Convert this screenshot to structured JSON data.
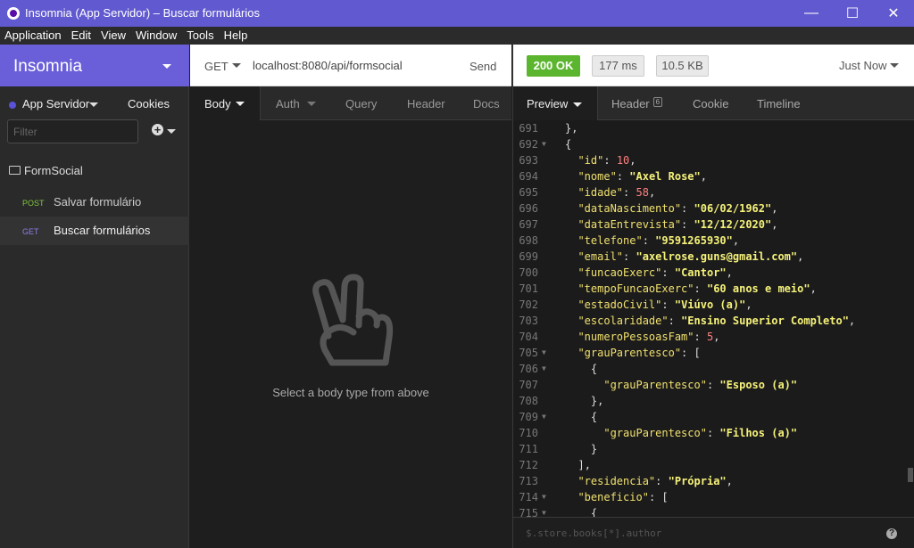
{
  "window": {
    "title": "Insomnia (App Servidor) – Buscar formulários",
    "minimize": "—",
    "maximize": "☐",
    "close": "✕"
  },
  "menu": [
    "Application",
    "Edit",
    "View",
    "Window",
    "Tools",
    "Help"
  ],
  "sidebar": {
    "app_name": "Insomnia",
    "workspace": "App Servidor",
    "cookies": "Cookies",
    "filter_placeholder": "Filter",
    "plus": "+",
    "folder": "FormSocial",
    "requests": [
      {
        "method": "POST",
        "name": "Salvar formulário"
      },
      {
        "method": "GET",
        "name": "Buscar formulários"
      }
    ]
  },
  "request": {
    "method": "GET",
    "url": "localhost:8080/api/formsocial",
    "send": "Send",
    "tabs": [
      "Body",
      "Auth",
      "Query",
      "Header",
      "Docs"
    ],
    "empty_message": "Select a body type from above"
  },
  "response": {
    "status": "200 OK",
    "time": "177 ms",
    "size": "10.5 KB",
    "when": "Just Now",
    "tabs": [
      "Preview",
      "Header",
      "Cookie",
      "Timeline"
    ],
    "header_count": "6",
    "filter_placeholder": "$.store.books[*].author",
    "help": "?",
    "lines": [
      {
        "n": "691",
        "f": "",
        "t": "},"
      },
      {
        "n": "692",
        "f": "▼",
        "t": "{"
      },
      {
        "n": "693",
        "f": "",
        "t": "  \"id\": 10,"
      },
      {
        "n": "694",
        "f": "",
        "t": "  \"nome\": \"Axel Rose\","
      },
      {
        "n": "695",
        "f": "",
        "t": "  \"idade\": 58,"
      },
      {
        "n": "696",
        "f": "",
        "t": "  \"dataNascimento\": \"06/02/1962\","
      },
      {
        "n": "697",
        "f": "",
        "t": "  \"dataEntrevista\": \"12/12/2020\","
      },
      {
        "n": "698",
        "f": "",
        "t": "  \"telefone\": \"9591265930\","
      },
      {
        "n": "699",
        "f": "",
        "t": "  \"email\": \"axelrose.guns@gmail.com\","
      },
      {
        "n": "700",
        "f": "",
        "t": "  \"funcaoExerc\": \"Cantor\","
      },
      {
        "n": "701",
        "f": "",
        "t": "  \"tempoFuncaoExerc\": \"60 anos e meio\","
      },
      {
        "n": "702",
        "f": "",
        "t": "  \"estadoCivil\": \"Viúvo (a)\","
      },
      {
        "n": "703",
        "f": "",
        "t": "  \"escolaridade\": \"Ensino Superior Completo\","
      },
      {
        "n": "704",
        "f": "",
        "t": "  \"numeroPessoasFam\": 5,"
      },
      {
        "n": "705",
        "f": "▼",
        "t": "  \"grauParentesco\": ["
      },
      {
        "n": "706",
        "f": "▼",
        "t": "    {"
      },
      {
        "n": "707",
        "f": "",
        "t": "      \"grauParentesco\": \"Esposo (a)\""
      },
      {
        "n": "708",
        "f": "",
        "t": "    },"
      },
      {
        "n": "709",
        "f": "▼",
        "t": "    {"
      },
      {
        "n": "710",
        "f": "",
        "t": "      \"grauParentesco\": \"Filhos (a)\""
      },
      {
        "n": "711",
        "f": "",
        "t": "    }"
      },
      {
        "n": "712",
        "f": "",
        "t": "  ],"
      },
      {
        "n": "713",
        "f": "",
        "t": "  \"residencia\": \"Própria\","
      },
      {
        "n": "714",
        "f": "▼",
        "t": "  \"beneficio\": ["
      },
      {
        "n": "715",
        "f": "▼",
        "t": "    {"
      }
    ]
  }
}
